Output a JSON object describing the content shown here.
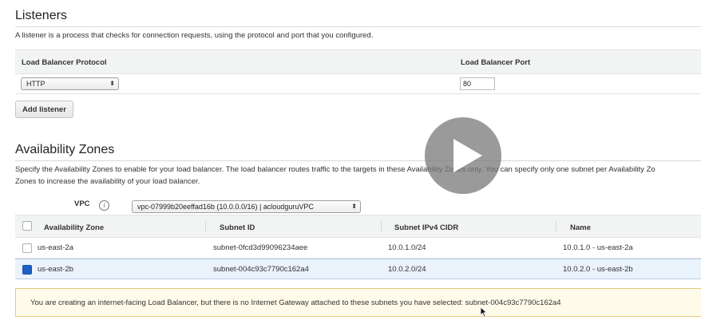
{
  "listeners": {
    "title": "Listeners",
    "description": "A listener is a process that checks for connection requests, using the protocol and port that you configured.",
    "col_protocol": "Load Balancer Protocol",
    "col_port": "Load Balancer Port",
    "protocol_value": "HTTP",
    "port_value": "80",
    "add_label": "Add listener"
  },
  "az": {
    "title": "Availability Zones",
    "description_line1": "Specify the Availability Zones to enable for your load balancer. The load balancer routes traffic to the targets in these Availability Zones only. You can specify only one subnet per Availability Zo",
    "description_line2": "Zones to increase the availability of your load balancer.",
    "vpc_label": "VPC",
    "vpc_value": "vpc-07999b20eeffad16b (10.0.0.0/16) | acloudguruVPC",
    "columns": {
      "zone": "Availability Zone",
      "subnet": "Subnet ID",
      "cidr": "Subnet IPv4 CIDR",
      "name": "Name"
    },
    "rows": [
      {
        "zone": "us-east-2a",
        "subnet": "subnet-0fcd3d99096234aee",
        "cidr": "10.0.1.0/24",
        "name": "10.0.1.0 - us-east-2a",
        "checked": false
      },
      {
        "zone": "us-east-2b",
        "subnet": "subnet-004c93c7790c162a4",
        "cidr": "10.0.2.0/24",
        "name": "10.0.2.0 - us-east-2b",
        "checked": true
      }
    ]
  },
  "warning": {
    "text": "You are creating an internet-facing Load Balancer, but there is no Internet Gateway attached to these subnets you have selected: subnet-004c93c7790c162a4"
  },
  "colors": {
    "accent": "#1f5fc9",
    "warning_bg": "#fffbea",
    "warning_border": "#e8c77a"
  },
  "icons": {
    "info": "info-icon",
    "play": "play-icon",
    "cursor": "mouse-cursor-icon"
  }
}
